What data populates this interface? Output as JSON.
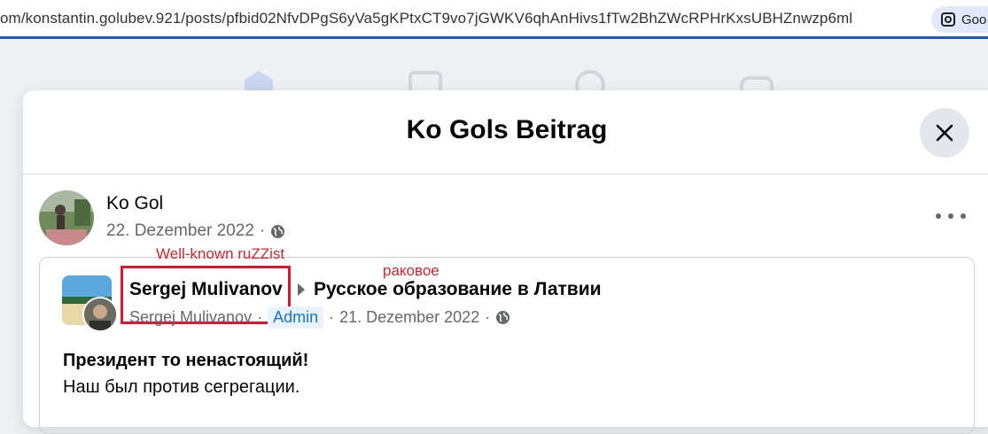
{
  "browser": {
    "url": "om/konstantin.golubev.921/posts/pfbid02NfvDPgS6yVa5gKPtxCT9vo7jGWKV6qhAnHivs1fTw2BhZWcRPHrKxsUBHZnwzp6ml",
    "lens_label": "Goo"
  },
  "modal": {
    "title": "Ko Gols Beitrag"
  },
  "post": {
    "author": "Ko Gol",
    "date": "22. Dezember 2022",
    "separator": "·"
  },
  "shared": {
    "author": "Sergej Mulivanov",
    "group": "Русское образование в Латвии",
    "sub_author": "Sergej Mulivanov",
    "role_badge": "Admin",
    "date": "21. Dezember 2022",
    "separator": "·",
    "text_line1": "Президент то ненастоящий!",
    "text_line2": "Наш был против сегрегации."
  },
  "annotations": {
    "label_author": "Well-known ruZZist",
    "label_group": "раковое",
    "color": "#d8232a"
  },
  "colors": {
    "accent": "#1a56c4",
    "secondary_text": "#65676b",
    "badge_bg": "#e7f3ff",
    "badge_text": "#1a73c9"
  }
}
